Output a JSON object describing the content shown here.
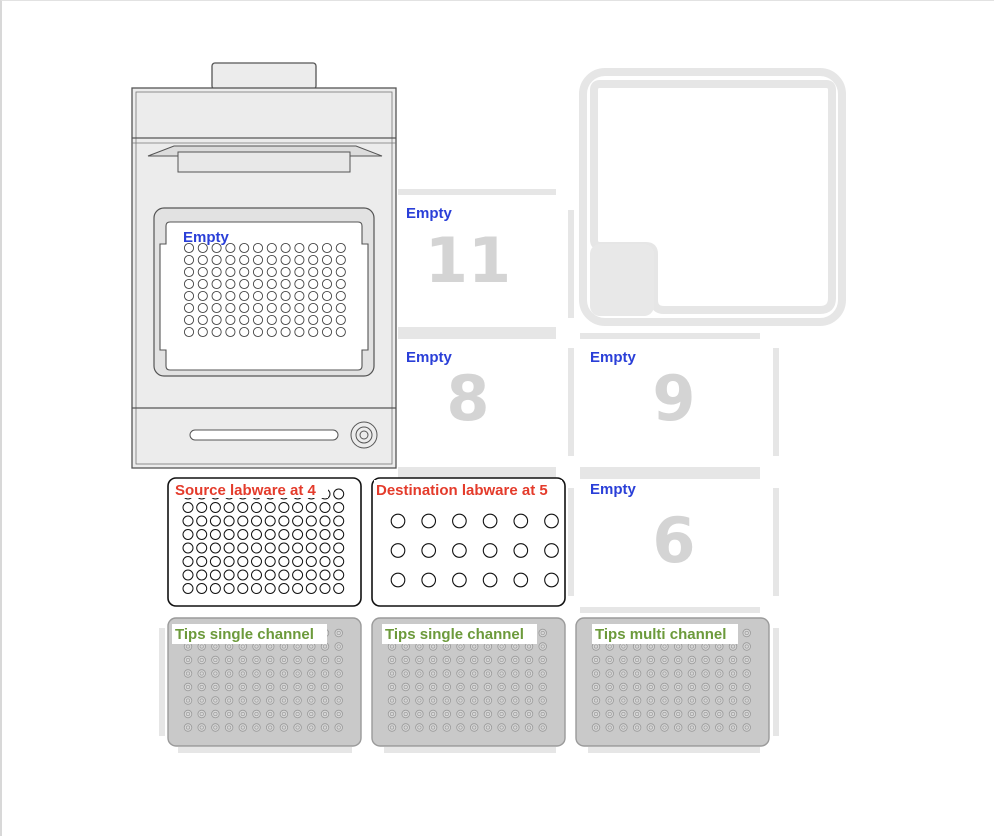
{
  "deck": {
    "slots": [
      {
        "number": "11",
        "label": "Empty"
      },
      {
        "number": "8",
        "label": "Empty"
      },
      {
        "number": "9",
        "label": "Empty"
      },
      {
        "number": "6",
        "label": "Empty"
      }
    ],
    "module": {
      "label": "Empty",
      "icon": "thermocycler-module-icon"
    },
    "trash": {
      "icon": "trash-bin-icon"
    },
    "labware": [
      {
        "label": "Source labware at 4",
        "color": "#e43b2b",
        "wells": "96"
      },
      {
        "label": "Destination labware at 5",
        "color": "#e43b2b",
        "wells": "24"
      },
      {
        "label": "Tips single channel",
        "color": "#6c9a3b",
        "wells": "96"
      },
      {
        "label": "Tips single channel",
        "color": "#6c9a3b",
        "wells": "96"
      },
      {
        "label": "Tips multi channel",
        "color": "#6c9a3b",
        "wells": "96"
      }
    ]
  }
}
